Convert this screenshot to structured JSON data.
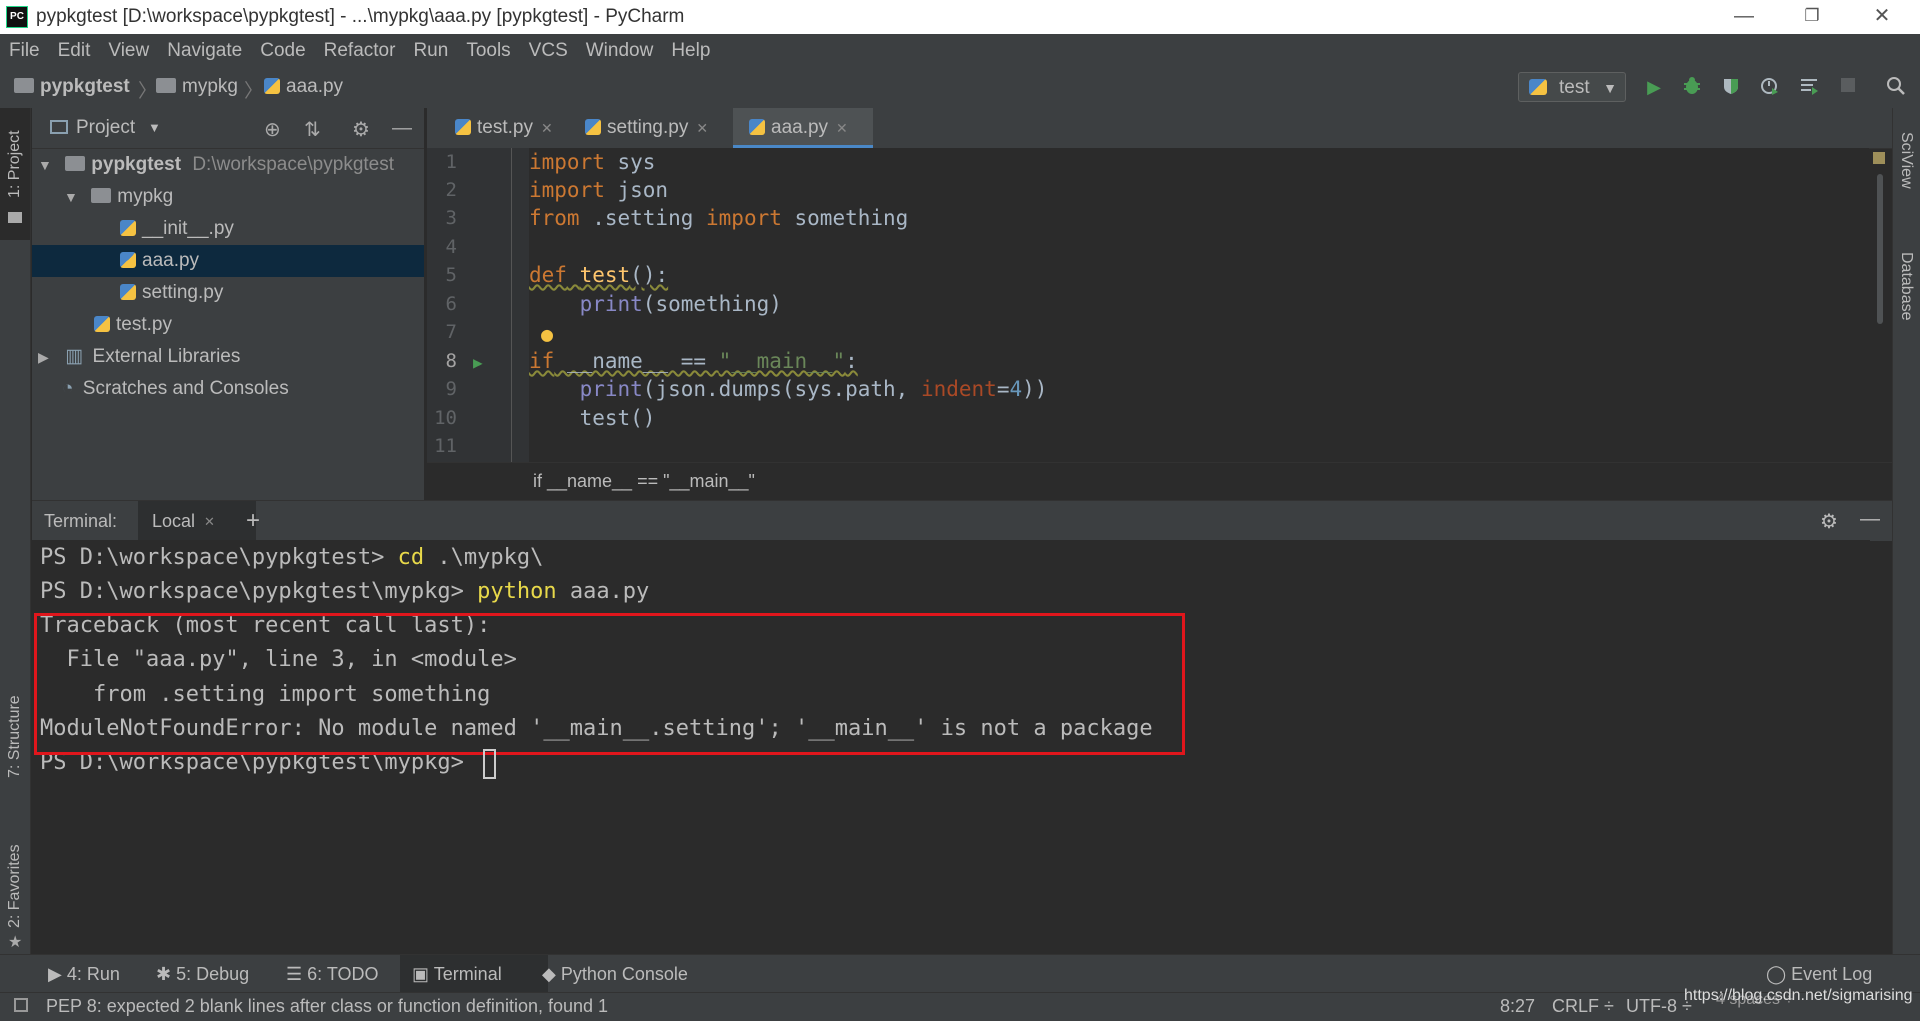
{
  "window": {
    "title": "pypkgtest [D:\\workspace\\pypkgtest] - ...\\mypkg\\aaa.py [pypkgtest] - PyCharm",
    "logo": "PC",
    "minimize": "—",
    "restore": "❐",
    "close": "✕"
  },
  "menu": [
    "File",
    "Edit",
    "View",
    "Navigate",
    "Code",
    "Refactor",
    "Run",
    "Tools",
    "VCS",
    "Window",
    "Help"
  ],
  "navbar": {
    "crumbs": [
      "pypkgtest",
      "mypkg",
      "aaa.py"
    ],
    "sep": "〉",
    "run_config": "test",
    "icons": [
      "run-icon",
      "debug-icon",
      "coverage-icon",
      "profile-icon",
      "concurrency-icon",
      "stop-icon",
      "search-icon"
    ]
  },
  "side_tabs": {
    "left_top": "1: Project",
    "left_structure": "7: Structure",
    "left_favorites": "2: Favorites",
    "right_sciview": "SciView",
    "right_database": "Database"
  },
  "project": {
    "header": "Project",
    "tree": [
      {
        "name": "pypkgtest",
        "path": "D:\\workspace\\pypkgtest"
      },
      {
        "name": "mypkg"
      },
      {
        "name": "__init__.py"
      },
      {
        "name": "aaa.py"
      },
      {
        "name": "setting.py"
      },
      {
        "name": "test.py"
      },
      {
        "name": "External Libraries"
      },
      {
        "name": "Scratches and Consoles"
      }
    ]
  },
  "editor": {
    "tabs": [
      "test.py",
      "setting.py",
      "aaa.py"
    ],
    "line_numbers": [
      "1",
      "2",
      "3",
      "4",
      "5",
      "6",
      "7",
      "8",
      "9",
      "10",
      "11"
    ],
    "breadcrumb": "if __name__ == \"__main__\"",
    "code": {
      "l1": [
        "import",
        " sys"
      ],
      "l2": [
        "import",
        " json"
      ],
      "l3": [
        "from",
        " .setting ",
        "import",
        " something"
      ],
      "l5": [
        "def",
        " ",
        "test",
        "():"
      ],
      "l6": [
        "    ",
        "print",
        "(something)"
      ],
      "l8": [
        "if",
        " __name__ == ",
        "\"__main__\"",
        ":"
      ],
      "l9": [
        "    ",
        "print",
        "(json.dumps(sys.path, ",
        "indent",
        "=",
        "4",
        "))"
      ],
      "l10": [
        "    test()"
      ]
    }
  },
  "terminal": {
    "label": "Terminal:",
    "tab": "Local",
    "add": "+",
    "lines": {
      "l1_prompt": "PS D:\\workspace\\pypkgtest> ",
      "l1_cmd": "cd",
      "l1_rest": " .\\mypkg\\",
      "l2_prompt": "PS D:\\workspace\\pypkgtest\\mypkg> ",
      "l2_cmd": "python",
      "l2_rest": " aaa.py",
      "l3": "Traceback (most recent call last):",
      "l4": "  File \"aaa.py\", line 3, in <module>",
      "l5": "    from .setting import something",
      "l6": "ModuleNotFoundError: No module named '__main__.setting'; '__main__' is not a package",
      "l7": "PS D:\\workspace\\pypkgtest\\mypkg> "
    }
  },
  "bottom_tools": {
    "run": "4: Run",
    "debug": "5: Debug",
    "todo": "6: TODO",
    "terminal": "Terminal",
    "python_console": "Python Console",
    "event_log": "Event Log"
  },
  "status": {
    "message": "PEP 8: expected 2 blank lines after class or function definition, found 1",
    "position": "8:27",
    "line_sep": "CRLF ÷",
    "encoding": "UTF-8 ÷",
    "indent": "4 spaces ÷",
    "watermark": "https://blog.csdn.net/sigmarising"
  },
  "colors": {
    "accent": "#4a88c7",
    "error_box": "#e0161c",
    "run_green": "#499c54",
    "selection": "#0d293e"
  }
}
